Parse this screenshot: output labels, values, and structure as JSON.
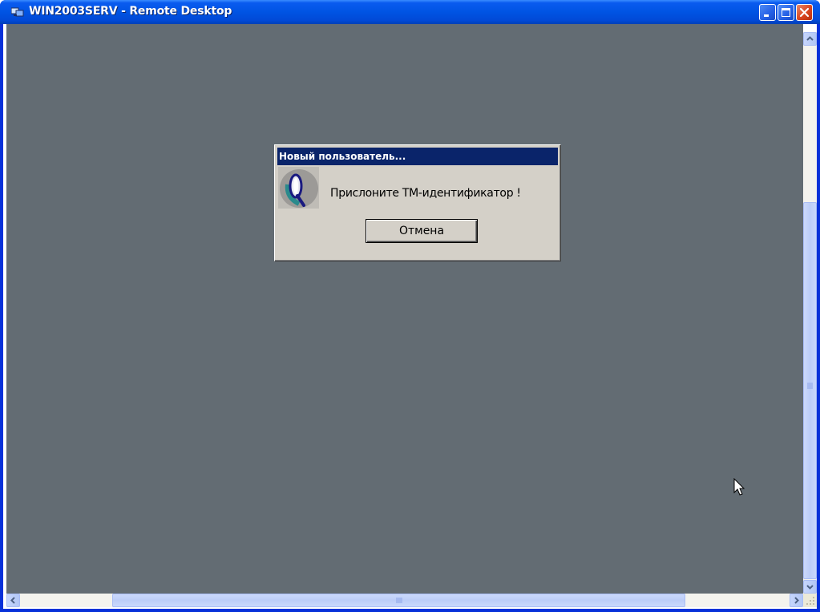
{
  "window": {
    "title": "WIN2003SERV - Remote Desktop",
    "icon": "remote-desktop-icon",
    "buttons": [
      "minimize-icon",
      "maximize-icon",
      "close-icon"
    ]
  },
  "dialog": {
    "title": "Новый пользователь...",
    "icon": "touch-memory-reader-icon",
    "message": "Прислоните ТМ-идентификатор !",
    "cancel_label": "Отмена"
  },
  "colors": {
    "desktop": "#636c73",
    "titlebar": "#0054e3",
    "dialog_title": "#0a246a",
    "dialog_face": "#d4d0c8"
  }
}
